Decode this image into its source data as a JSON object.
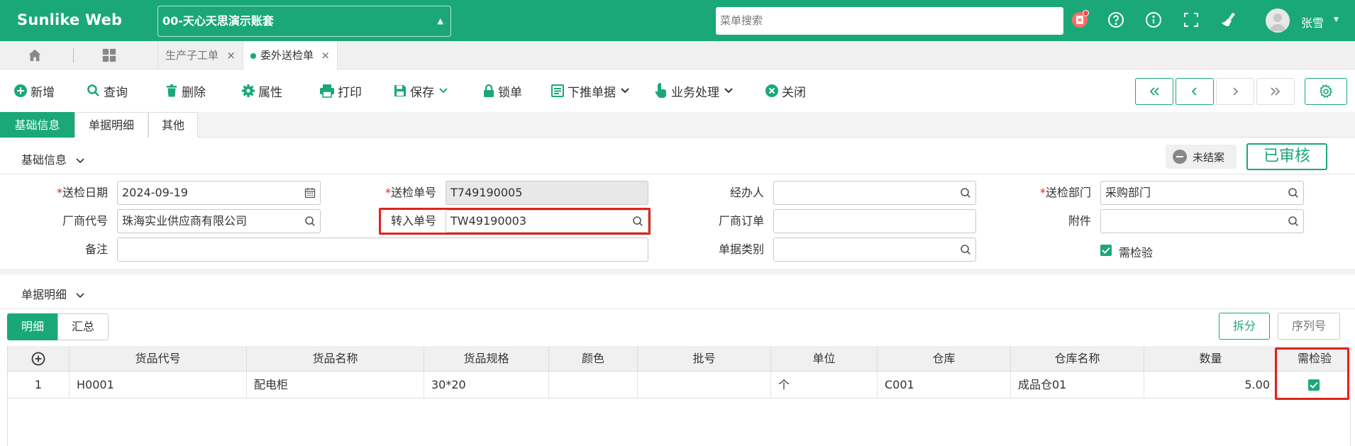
{
  "app": {
    "brand": "Sunlike Web",
    "account": "00-天心天思演示账套"
  },
  "header": {
    "search_placeholder": "菜单搜索",
    "user": "张雪"
  },
  "tabs": [
    {
      "label": "生产子工单",
      "active": false
    },
    {
      "label": "委外送检单",
      "active": true
    }
  ],
  "toolbar": {
    "add": "新增",
    "query": "查询",
    "delete": "删除",
    "properties": "属性",
    "print": "打印",
    "save": "保存",
    "lock": "锁单",
    "push": "下推单据",
    "business": "业务处理",
    "close": "关闭"
  },
  "section_tabs": [
    "基础信息",
    "单据明细",
    "其他"
  ],
  "basic": {
    "header": "基础信息",
    "status": "未结案",
    "approved": "已审核"
  },
  "form": {
    "inspect_date": {
      "label": "送检日期",
      "value": "2024-09-19"
    },
    "inspect_no": {
      "label": "送检单号",
      "value": "T749190005"
    },
    "handler": {
      "label": "经办人",
      "value": ""
    },
    "inspect_dept": {
      "label": "送检部门",
      "value": "采购部门"
    },
    "vendor_code": {
      "label": "厂商代号",
      "value": "珠海实业供应商有限公司"
    },
    "transfer_no": {
      "label": "转入单号",
      "value": "TW49190003"
    },
    "vendor_order": {
      "label": "厂商订单",
      "value": ""
    },
    "attachment": {
      "label": "附件",
      "value": ""
    },
    "remark": {
      "label": "备注",
      "value": ""
    },
    "doc_type": {
      "label": "单据类别",
      "value": ""
    },
    "need_inspect": {
      "label": "需检验",
      "checked": true
    }
  },
  "detail": {
    "header": "单据明细",
    "seg_detail": "明细",
    "seg_summary": "汇总",
    "split": "拆分",
    "serial": "序列号",
    "columns": [
      "货品代号",
      "货品名称",
      "货品规格",
      "颜色",
      "批号",
      "单位",
      "仓库",
      "仓库名称",
      "数量",
      "需检验"
    ],
    "rows": [
      {
        "idx": "1",
        "code": "H0001",
        "name": "配电柜",
        "spec": "30*20",
        "color": "",
        "batch": "",
        "unit": "个",
        "wh": "C001",
        "wh_name": "成品仓01",
        "qty": "5.00",
        "need_inspect": true
      }
    ]
  },
  "colors": {
    "primary": "#1aa878",
    "highlight": "#e2231a"
  }
}
